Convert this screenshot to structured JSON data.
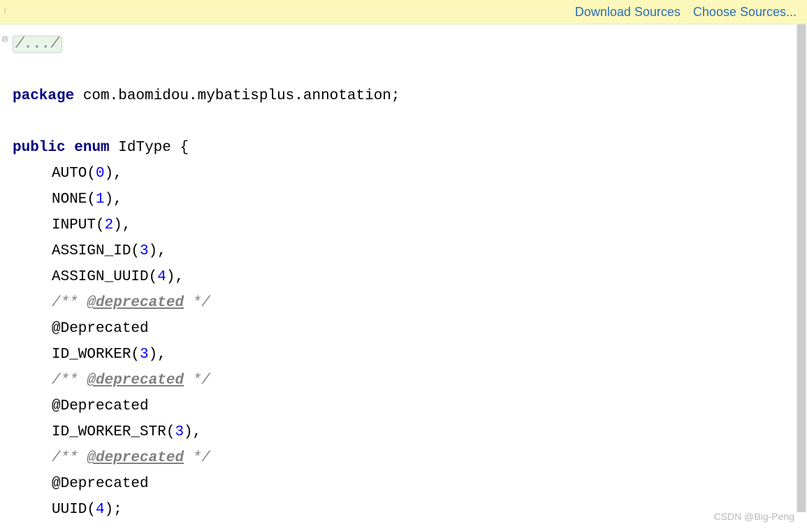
{
  "banner": {
    "download_label": "Download Sources",
    "choose_label": "Choose Sources..."
  },
  "code": {
    "folded": "/.../",
    "package_kw": "package",
    "package_name": " com.baomidou.mybatisplus.annotation;",
    "public_kw": "public",
    "enum_kw": "enum",
    "class_name": " IdType {",
    "enum_auto": "AUTO(",
    "enum_auto_val": "0",
    "enum_none": "NONE(",
    "enum_none_val": "1",
    "enum_input": "INPUT(",
    "enum_input_val": "2",
    "enum_assign_id": "ASSIGN_ID(",
    "enum_assign_id_val": "3",
    "enum_assign_uuid": "ASSIGN_UUID(",
    "enum_assign_uuid_val": "4",
    "comment_open": "/** ",
    "deprecated_tag": "@deprecated",
    "comment_close": " */",
    "deprecated_ann": "@Deprecated",
    "enum_id_worker": "ID_WORKER(",
    "enum_id_worker_val": "3",
    "enum_id_worker_str": "ID_WORKER_STR(",
    "enum_id_worker_str_val": "3",
    "enum_uuid": "UUID(",
    "enum_uuid_val": "4",
    "close_comma": "),",
    "close_semi": ");"
  },
  "watermark": "CSDN @Big-Peng"
}
